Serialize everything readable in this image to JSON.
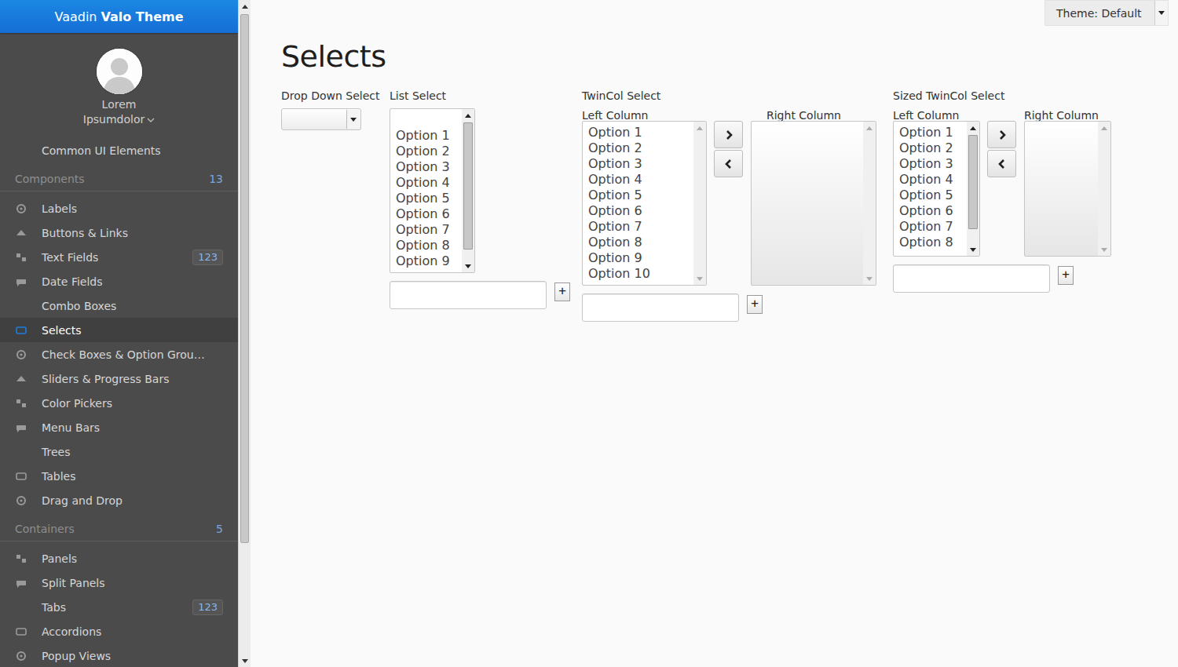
{
  "header": {
    "prefix": "Vaadin",
    "bold": "Valo Theme"
  },
  "user": {
    "first": "Lorem",
    "last": "Ipsumdolor"
  },
  "menu": [
    {
      "kind": "item",
      "label": "Common UI Elements",
      "selected": false
    },
    {
      "kind": "section",
      "label": "Components",
      "count": "13"
    },
    {
      "kind": "item",
      "label": "Labels",
      "selected": false
    },
    {
      "kind": "item",
      "label": "Buttons & Links",
      "selected": false
    },
    {
      "kind": "item",
      "label": "Text Fields",
      "badge": "123",
      "selected": false
    },
    {
      "kind": "item",
      "label": "Date Fields",
      "selected": false
    },
    {
      "kind": "item",
      "label": "Combo Boxes",
      "selected": false
    },
    {
      "kind": "item",
      "label": "Selects",
      "selected": true
    },
    {
      "kind": "item",
      "label": "Check Boxes & Option Grou…",
      "selected": false
    },
    {
      "kind": "item",
      "label": "Sliders & Progress Bars",
      "selected": false
    },
    {
      "kind": "item",
      "label": "Color Pickers",
      "selected": false
    },
    {
      "kind": "item",
      "label": "Menu Bars",
      "selected": false
    },
    {
      "kind": "item",
      "label": "Trees",
      "selected": false
    },
    {
      "kind": "item",
      "label": "Tables",
      "selected": false
    },
    {
      "kind": "item",
      "label": "Drag and Drop",
      "selected": false
    },
    {
      "kind": "section",
      "label": "Containers",
      "count": "5"
    },
    {
      "kind": "item",
      "label": "Panels",
      "selected": false
    },
    {
      "kind": "item",
      "label": "Split Panels",
      "selected": false
    },
    {
      "kind": "item",
      "label": "Tabs",
      "badge": "123",
      "selected": false
    },
    {
      "kind": "item",
      "label": "Accordions",
      "selected": false
    },
    {
      "kind": "item",
      "label": "Popup Views",
      "selected": false
    }
  ],
  "theme_select": {
    "label": "Theme: Default"
  },
  "page_title": "Selects",
  "drop_down": {
    "caption": "Drop Down Select"
  },
  "list_select": {
    "caption": "List Select",
    "options": [
      "Option 1",
      "Option 2",
      "Option 3",
      "Option 4",
      "Option 5",
      "Option 6",
      "Option 7",
      "Option 8",
      "Option 9"
    ],
    "scrollable": true,
    "add_label": "+"
  },
  "twincol": {
    "caption": "TwinCol Select",
    "left_caption": "Left Column",
    "right_caption": "Right Column",
    "left_options": [
      "Option 1",
      "Option 2",
      "Option 3",
      "Option 4",
      "Option 5",
      "Option 6",
      "Option 7",
      "Option 8",
      "Option 9",
      "Option 10"
    ],
    "right_options": [],
    "left_scrollable": false,
    "add_label": "+"
  },
  "sized_twincol": {
    "caption": "Sized TwinCol Select",
    "left_caption": "Left Column",
    "right_caption": "Right Column",
    "left_options": [
      "Option 1",
      "Option 2",
      "Option 3",
      "Option 4",
      "Option 5",
      "Option 6",
      "Option 7",
      "Option 8"
    ],
    "right_options": [],
    "left_scrollable": true,
    "add_label": "+"
  }
}
